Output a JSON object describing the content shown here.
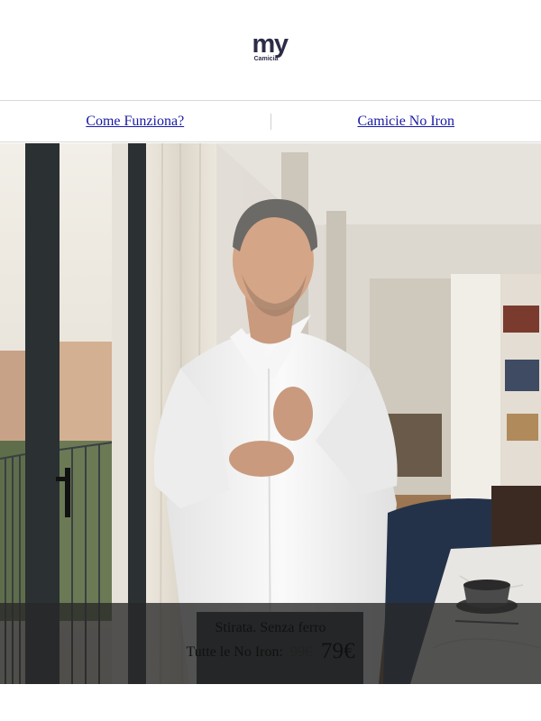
{
  "brand": {
    "logo_main": "my",
    "logo_sub": "Camicia",
    "color": "#2c2c48"
  },
  "nav": {
    "items": [
      {
        "label": "Come Funziona?"
      },
      {
        "label": "Camicie No Iron"
      }
    ],
    "link_color": "#1a1aa6"
  },
  "hero": {
    "caption": {
      "headline": "Stirata. Senza ferro",
      "offer_label": "Tutte le No Iron:",
      "old_price": "99€",
      "new_price": "79€"
    }
  }
}
